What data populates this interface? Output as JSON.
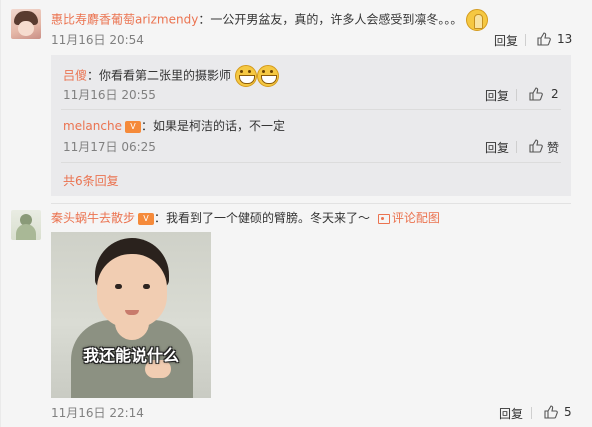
{
  "comments": [
    {
      "user": "惠比寿麝香葡萄arizmendy",
      "text": "：一公开男盆友，真的，许多人会感受到凛冬。。。",
      "emoji": "pray-emoji",
      "time": "11月16日 20:54",
      "reply_label": "回复",
      "like_count": "13",
      "replies": [
        {
          "user": "吕傻",
          "text": "：你看看第二张里的摄影师",
          "emoji": "grin-emoji",
          "time": "11月16日 20:55",
          "reply_label": "回复",
          "like_count": "2"
        },
        {
          "user": "melanche",
          "vip_badge": "V",
          "text": "：如果是柯洁的话，不一定",
          "time": "11月17日 06:25",
          "reply_label": "回复",
          "like_label": "赞"
        }
      ],
      "more_replies": "共6条回复"
    },
    {
      "user": "秦头蜗牛去散步",
      "vip_badge": "V",
      "text": "：我看到了一个健硕的臂膀。冬天来了～",
      "link": "评论配图",
      "image_caption": "我还能说什么",
      "time": "11月16日 22:14",
      "reply_label": "回复",
      "like_count": "5"
    }
  ],
  "colors": {
    "username": "#eb7350",
    "text": "#333333",
    "time": "#808080",
    "reply_bg": "#eaeaec",
    "page_bg": "#f5f5f5"
  },
  "icons": [
    "thumbs-up-icon",
    "image-icon",
    "vip-badge-icon"
  ]
}
